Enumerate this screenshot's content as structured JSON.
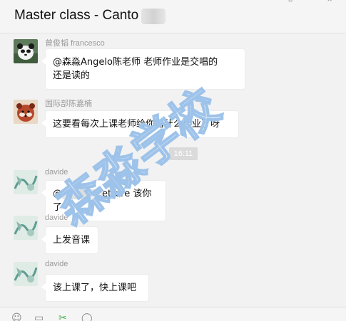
{
  "header": {
    "title": "Master class - Canto"
  },
  "messages": [
    {
      "sender": "曾俊韬 francesco",
      "text_line1": "@森淼Angelo陈老师 老师作业是交唱的",
      "text_line2": "还是读的"
    },
    {
      "sender": "国际部陈嘉楠",
      "text": "这要看每次上课老师给你留什么作业了呀"
    },
    {
      "sender": "davide",
      "text_prefix": "@",
      "text_suffix": "ettore 该你了"
    },
    {
      "sender": "davide",
      "text": "上发音课"
    },
    {
      "sender": "davide",
      "text": "该上课了，快上课吧"
    }
  ],
  "timestamp": "16:11",
  "watermark": {
    "text": "森淼学校",
    "color": "#9ec3ea"
  },
  "colors": {
    "background": "#f2f2f2",
    "bubble": "#ffffff",
    "sender": "#9a9a9a",
    "emoji_active": "#4caf50"
  },
  "toolbar": {
    "icons": [
      "emoji-icon",
      "folder-icon",
      "scissors-icon",
      "chat-history-icon"
    ]
  }
}
